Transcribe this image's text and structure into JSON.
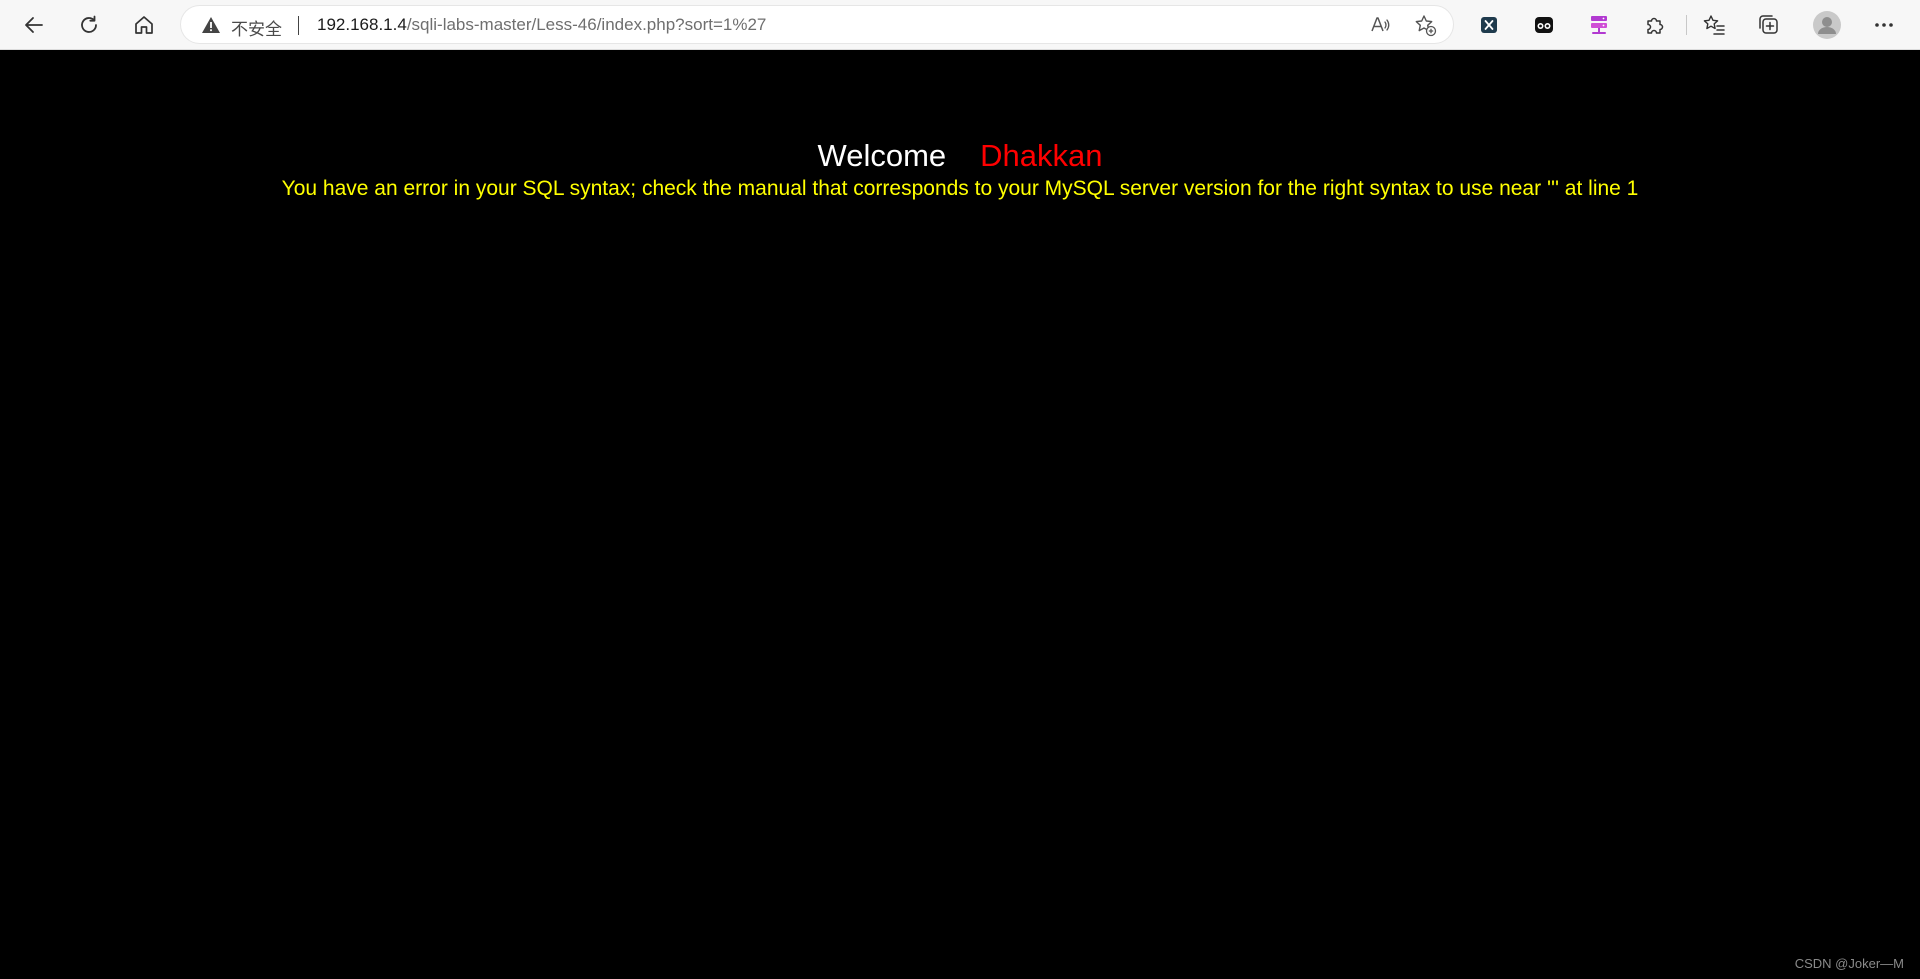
{
  "browser": {
    "address_bar": {
      "security_label": "不安全",
      "url_host": "192.168.1.4",
      "url_path": "/sqli-labs-master/Less-46/index.php?sort=1%27"
    },
    "nav_icons": [
      "back-arrow-icon",
      "refresh-icon",
      "home-icon"
    ],
    "address_icons": [
      "warning-icon",
      "read-aloud-icon",
      "add-favorite-icon"
    ],
    "extension_icons": [
      "extension-x-icon",
      "extension-glasses-icon",
      "extension-server-icon",
      "extensions-puzzle-icon"
    ],
    "toolbar_icons": [
      "favorites-icon",
      "collections-icon",
      "profile-avatar-icon",
      "more-menu-icon"
    ]
  },
  "page": {
    "welcome_word": "Welcome",
    "welcome_name": "Dhakkan",
    "error_message": "You have an error in your SQL syntax; check the manual that corresponds to your MySQL server version for the right syntax to use near ''' at line 1",
    "watermark": "CSDN @Joker—M"
  },
  "colors": {
    "background": "#000000",
    "welcome": "#ffffff",
    "name": "#ff0000",
    "error": "#ffff00"
  }
}
